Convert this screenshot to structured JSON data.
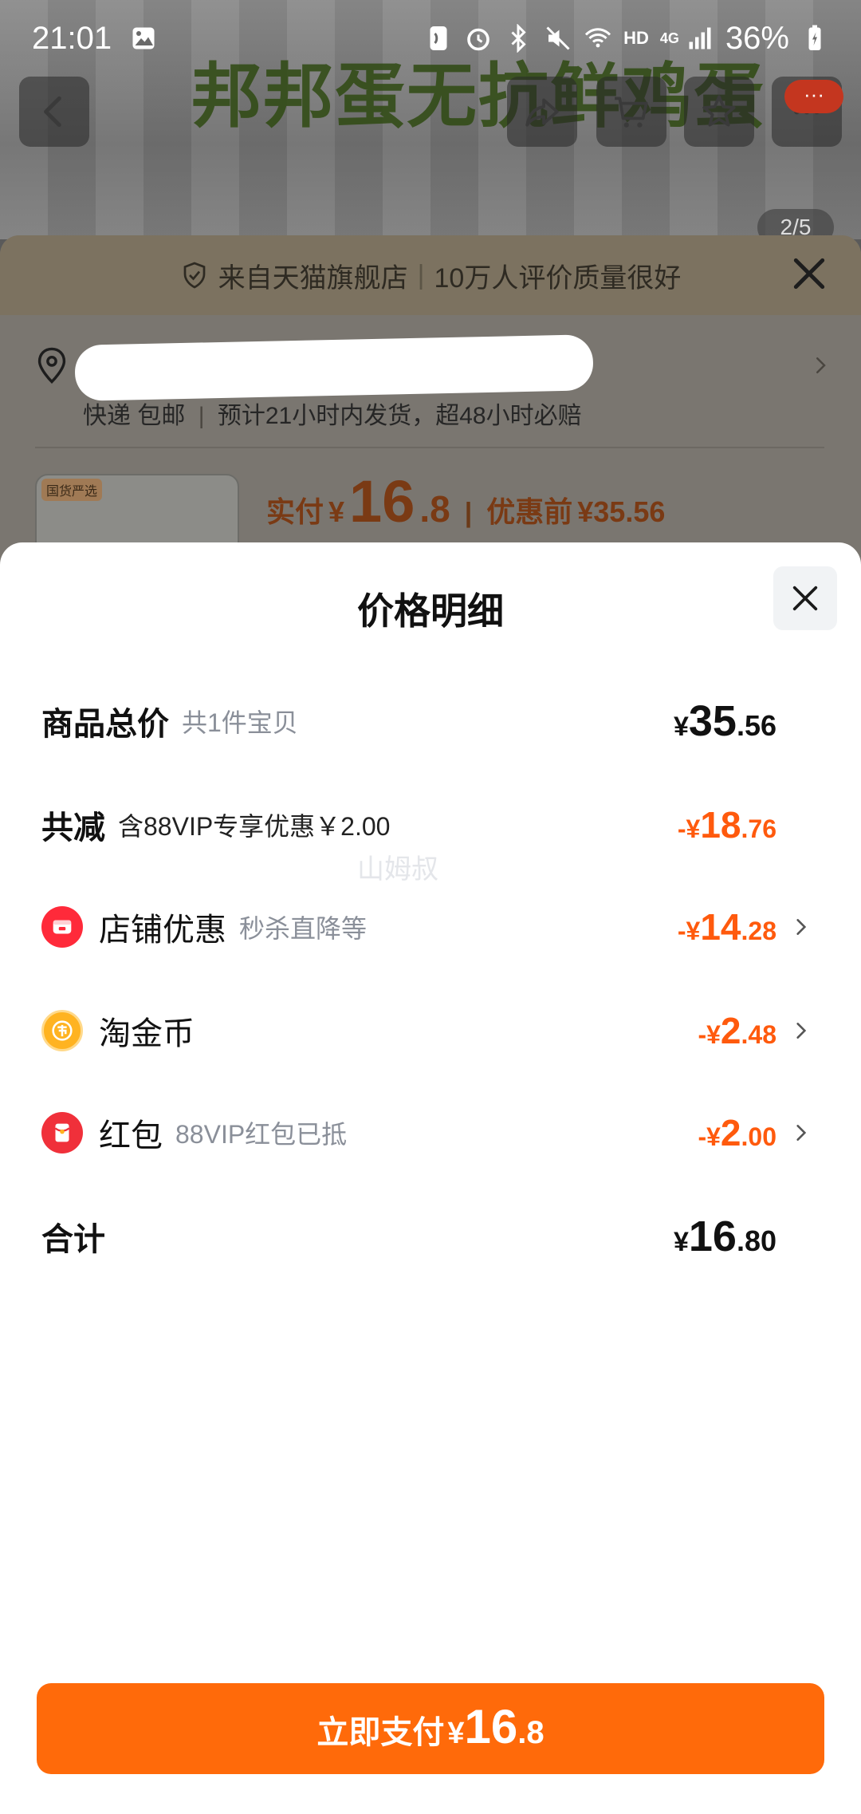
{
  "status_bar": {
    "time": "21:01",
    "network": "HD",
    "network_type": "4G",
    "battery": "36%"
  },
  "background": {
    "banner_text": "邦邦蛋无抗鲜鸡蛋",
    "notification_count": "···",
    "image_counter": "2/5"
  },
  "under_sheet": {
    "store_banner": {
      "left": "来自天猫旗舰店",
      "right": "10万人评价质量很好"
    },
    "shipping_line": {
      "method": "快递 包邮",
      "promise": "预计21小时内发货，超48小时必赔"
    },
    "thumb_tag": "国货严选",
    "price": {
      "actual_label": "实付",
      "actual_currency": "¥",
      "actual_int": "16",
      "actual_dec": ".8",
      "original_label": "优惠前",
      "original_value": "¥35.56"
    }
  },
  "sheet": {
    "title": "价格明细",
    "rows": {
      "total": {
        "label": "商品总价",
        "sub": "共1件宝贝",
        "cur": "¥",
        "int": "35",
        "dec": ".56"
      },
      "discount": {
        "label": "共减",
        "sub": "含88VIP专享优惠￥2.00",
        "cur": "-¥",
        "int": "18",
        "dec": ".76"
      },
      "shop": {
        "label": "店铺优惠",
        "sub": "秒杀直降等",
        "cur": "-¥",
        "int": "14",
        "dec": ".28"
      },
      "coin": {
        "label": "淘金币",
        "sub": "",
        "cur": "-¥",
        "int": "2",
        "dec": ".48"
      },
      "redpack": {
        "label": "红包",
        "sub": "88VIP红包已抵",
        "cur": "-¥",
        "int": "2",
        "dec": ".00"
      },
      "sum": {
        "label": "合计",
        "cur": "¥",
        "int": "16",
        "dec": ".80"
      }
    },
    "watermark": "山姆叔"
  },
  "pay_button": {
    "label": "立即支付",
    "cur": "¥",
    "int": "16",
    "dec": ".8"
  },
  "colors": {
    "accent_orange": "#ff6a0a",
    "discount_orange": "#ff5a0d",
    "shop_red": "#ff2a3a",
    "coin_gold": "#ffb321"
  },
  "icons": [
    "image-icon",
    "back-icon",
    "share-icon",
    "cart-icon",
    "star-icon",
    "more-icon",
    "shield-check-icon",
    "close-icon",
    "location-pin-icon",
    "chevron-right-icon",
    "shop-icon",
    "coin-icon",
    "red-packet-icon"
  ]
}
